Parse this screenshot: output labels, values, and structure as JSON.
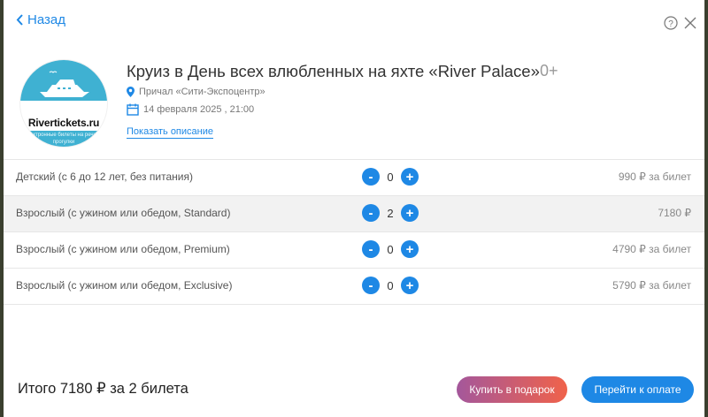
{
  "header": {
    "back_label": "Назад"
  },
  "event": {
    "title": "Круиз в День всех влюбленных на яхте «River Palace»",
    "age_rating": "0+",
    "place": "Причал «Сити-Экспоцентр»",
    "date": "14 февраля 2025 , 21:00",
    "description_link": "Показать описание",
    "logo": {
      "text": "Rivertickets.ru",
      "subtext": "электронные билеты на речные прогулки"
    }
  },
  "tickets": [
    {
      "name": "Детский (с 6 до 12 лет, без питания)",
      "quantity": "0",
      "price": "990 ₽ за билет"
    },
    {
      "name": "Взрослый (с ужином или обедом, Standard)",
      "quantity": "2",
      "price": "7180 ₽"
    },
    {
      "name": "Взрослый (с ужином или обедом, Premium)",
      "quantity": "0",
      "price": "4790 ₽ за билет"
    },
    {
      "name": "Взрослый (с ужином или обедом, Exclusive)",
      "quantity": "0",
      "price": "5790 ₽ за билет"
    }
  ],
  "stepper": {
    "minus": "-",
    "plus": "+"
  },
  "footer": {
    "total": "Итого 7180 ₽ за 2 билета",
    "gift_button": "Купить в подарок",
    "pay_button": "Перейти к оплате"
  },
  "colors": {
    "accent": "#1e88e5",
    "logo": "#3fb1d2",
    "gift_gradient_start": "#a4579b",
    "gift_gradient_end": "#f0624a"
  },
  "icons": [
    "chevron-left-icon",
    "help-icon",
    "close-icon",
    "location-pin-icon",
    "calendar-icon",
    "yacht-icon"
  ]
}
